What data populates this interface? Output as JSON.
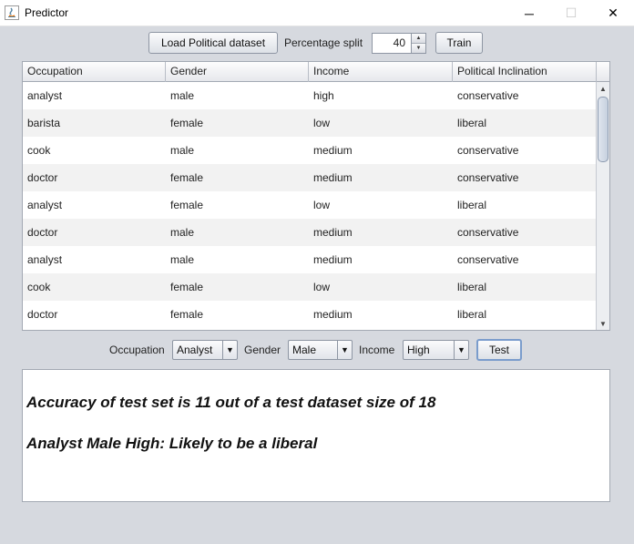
{
  "window": {
    "title": "Predictor",
    "minimize_glyph": "─",
    "maximize_glyph": "☐",
    "close_glyph": "✕"
  },
  "toolbar": {
    "load_button": "Load Political dataset",
    "percentage_label": "Percentage split",
    "percentage_value": "40",
    "spinner_up": "▲",
    "spinner_down": "▼",
    "train_button": "Train"
  },
  "table": {
    "columns": [
      "Occupation",
      "Gender",
      "Income",
      "Political Inclination"
    ],
    "rows": [
      [
        "analyst",
        "male",
        "high",
        "conservative"
      ],
      [
        "barista",
        "female",
        "low",
        "liberal"
      ],
      [
        "cook",
        "male",
        "medium",
        "conservative"
      ],
      [
        "doctor",
        "female",
        "medium",
        "conservative"
      ],
      [
        "analyst",
        "female",
        "low",
        "liberal"
      ],
      [
        "doctor",
        "male",
        "medium",
        "conservative"
      ],
      [
        "analyst",
        "male",
        "medium",
        "conservative"
      ],
      [
        "cook",
        "female",
        "low",
        "liberal"
      ],
      [
        "doctor",
        "female",
        "medium",
        "liberal"
      ]
    ],
    "scroll_up": "▲",
    "scroll_down": "▼"
  },
  "query": {
    "occupation_label": "Occupation",
    "occupation_value": "Analyst",
    "gender_label": "Gender",
    "gender_value": "Male",
    "income_label": "Income",
    "income_value": "High",
    "dropdown_glyph": "▼",
    "test_button": "Test"
  },
  "output": {
    "line1": "Accuracy of test set is 11 out of a test dataset size of 18",
    "line2": "Analyst Male High: Likely to be a liberal"
  },
  "colors": {
    "window_bg": "#d6d9df",
    "alt_row": "#f2f2f2",
    "border": "#8e96a3"
  }
}
